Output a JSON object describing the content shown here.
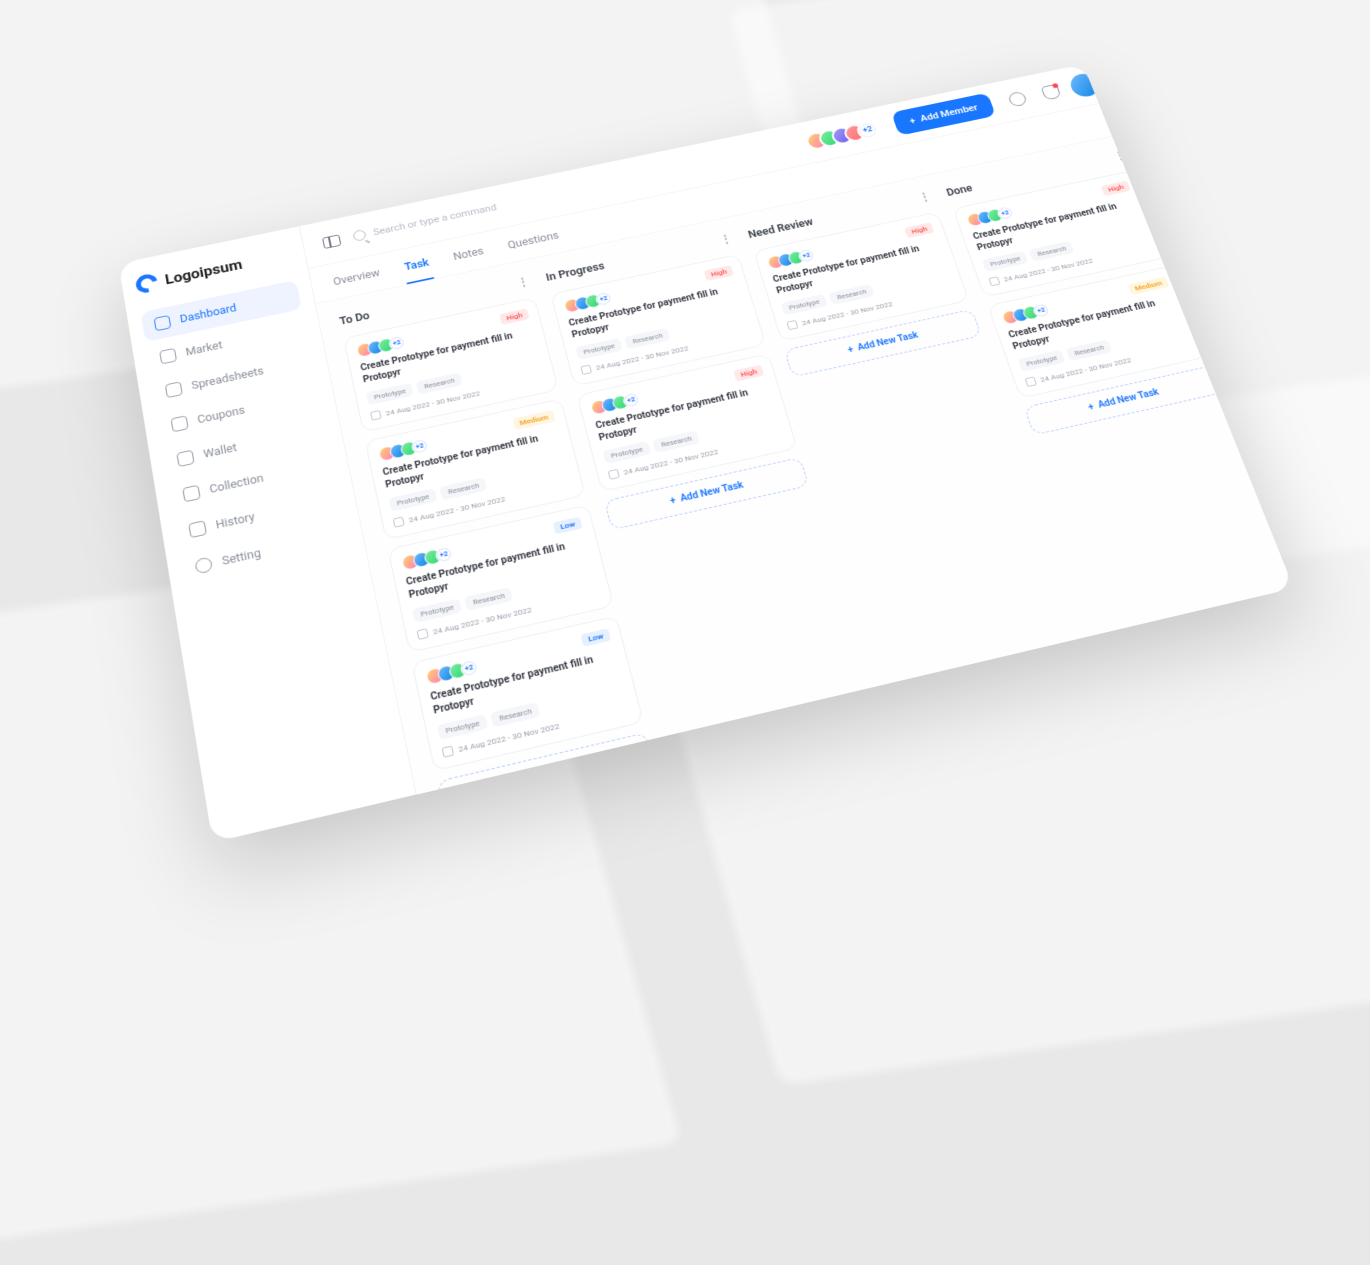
{
  "brand": "Logoipsum",
  "sidebar": {
    "items": [
      {
        "label": "Dashboard",
        "active": true
      },
      {
        "label": "Market"
      },
      {
        "label": "Spreadsheets"
      },
      {
        "label": "Coupons"
      },
      {
        "label": "Wallet"
      },
      {
        "label": "Collection"
      },
      {
        "label": "History"
      },
      {
        "label": "Setting"
      }
    ]
  },
  "search_placeholder": "Search or type a command",
  "member_overflow": "+2",
  "add_member_label": "Add Member",
  "tabs": [
    "Overview",
    "Task",
    "Notes",
    "Questions"
  ],
  "active_tab": 1,
  "task_title": "Create Prototype for payment fill in Protopyr",
  "chip_a": "Prototype",
  "chip_b": "Research",
  "date_range": "24 Aug 2022 - 30 Nov 2022",
  "priority": {
    "high": "High",
    "medium": "Medium",
    "low": "Low"
  },
  "add_task_label": "Add New Task",
  "card_overflow": "+2",
  "columns": [
    {
      "title": "To Do",
      "cards": [
        {
          "p": "high"
        },
        {
          "p": "medium"
        },
        {
          "p": "low"
        },
        {
          "p": "low"
        }
      ]
    },
    {
      "title": "In Progress",
      "cards": [
        {
          "p": "high"
        },
        {
          "p": "high"
        }
      ]
    },
    {
      "title": "Need Review",
      "cards": [
        {
          "p": "high"
        }
      ]
    },
    {
      "title": "Done",
      "cards": [
        {
          "p": "high"
        },
        {
          "p": "medium"
        }
      ]
    }
  ]
}
